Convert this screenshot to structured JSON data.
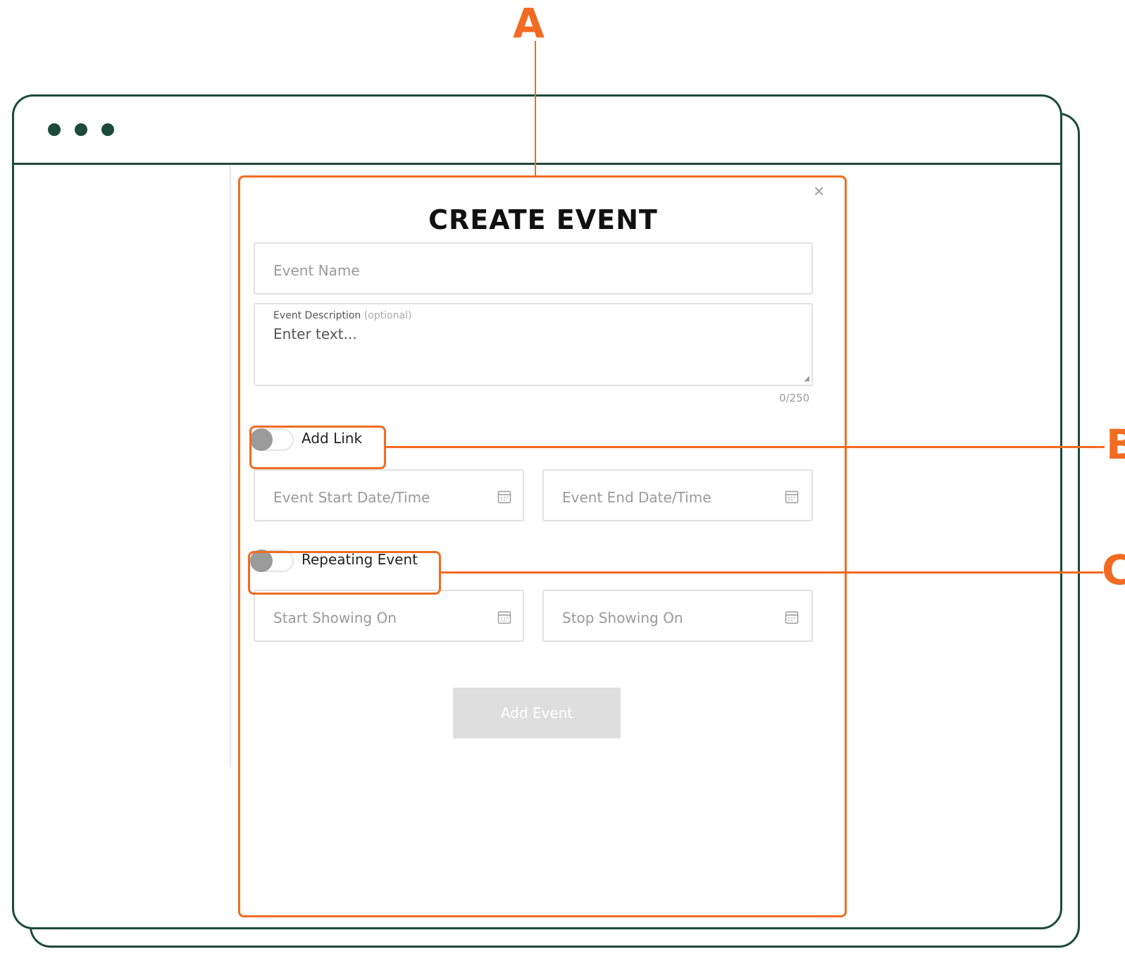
{
  "callouts": {
    "a": "A",
    "b": "B",
    "c": "C"
  },
  "modal": {
    "title": "CREATE EVENT",
    "close_icon": "×",
    "event_name_placeholder": "Event Name",
    "description_label": "Event Description",
    "description_optional": "(optional)",
    "description_placeholder": "Enter text...",
    "description_counter": "0/250",
    "add_link_label": "Add Link",
    "add_link_on": false,
    "start_datetime_placeholder": "Event Start Date/Time",
    "end_datetime_placeholder": "Event End Date/Time",
    "repeating_label": "Repeating Event",
    "repeating_on": false,
    "start_showing_placeholder": "Start Showing On",
    "stop_showing_placeholder": "Stop Showing On",
    "submit_label": "Add Event",
    "icons": {
      "close": "close-icon",
      "calendar": "calendar-icon"
    }
  },
  "colors": {
    "annotation": "#f26b22",
    "frame": "#1d4a3a",
    "toggle_off": "#9b9b9b",
    "button_disabled": "#dedede"
  }
}
